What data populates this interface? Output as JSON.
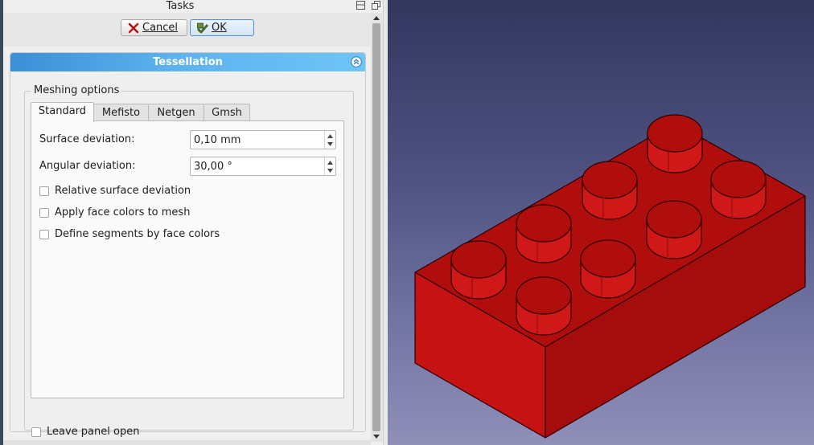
{
  "window": {
    "title": "Tasks"
  },
  "actions": {
    "cancel_label": "Cancel",
    "ok_label": "OK"
  },
  "task_panel": {
    "header": "Tessellation",
    "group_title": "Meshing options",
    "tabs": [
      "Standard",
      "Mefisto",
      "Netgen",
      "Gmsh"
    ],
    "active_tab": "Standard",
    "standard": {
      "surface_deviation_label": "Surface deviation:",
      "surface_deviation_value": "0,10 mm",
      "angular_deviation_label": "Angular deviation:",
      "angular_deviation_value": "30,00 °",
      "checkboxes": [
        {
          "label": "Relative surface deviation",
          "checked": false
        },
        {
          "label": "Apply face colors to mesh",
          "checked": false
        },
        {
          "label": "Define segments by face colors",
          "checked": false
        }
      ]
    },
    "leave_panel_open": {
      "label": "Leave panel open",
      "checked": false
    }
  },
  "viewport": {
    "object": "brick-2x4",
    "colors": {
      "top": "#b00d0d",
      "front": "#c61212",
      "side": "#a50c0c",
      "stud_side": "#d01818",
      "edge": "#2a0000"
    },
    "background_top": "#33375e",
    "background_bottom": "#8f8fb8"
  },
  "colors": {
    "header_start": "#3a8fd6",
    "header_end": "#6fc4f6",
    "ok_border": "#4f8fd6"
  }
}
